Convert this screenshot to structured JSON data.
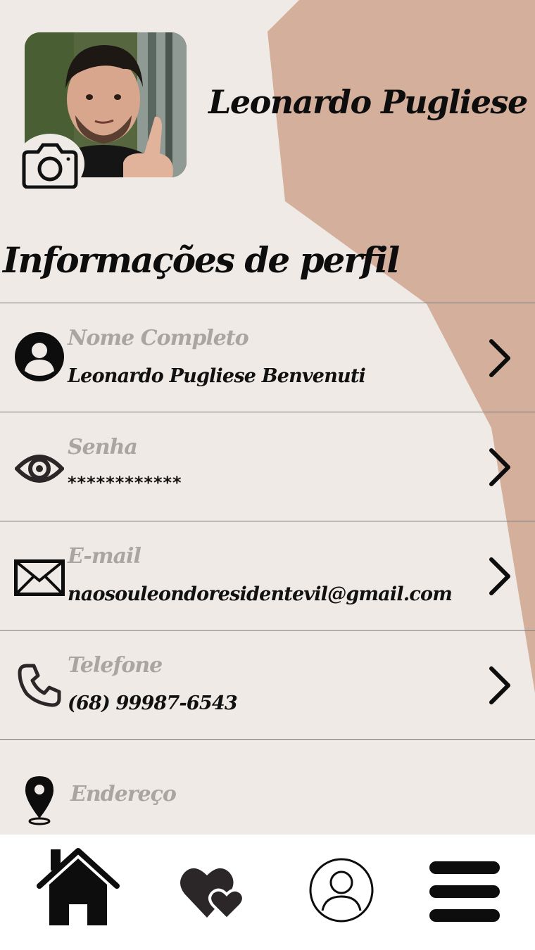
{
  "profile": {
    "name": "Leonardo Pugliese",
    "photo_alt": "avatar"
  },
  "section_title": "Informações de perfil",
  "fields": [
    {
      "label": "Nome Completo",
      "value": "Leonardo Pugliese Benvenuti",
      "icon": "user-circle-icon"
    },
    {
      "label": "Senha",
      "value": "************",
      "icon": "eye-icon"
    },
    {
      "label": "E-mail",
      "value": "naosouleondoresidentevil@gmail.com",
      "icon": "envelope-icon"
    },
    {
      "label": "Telefone",
      "value": "(68) 99987-6543",
      "icon": "phone-icon"
    },
    {
      "label": "Endereço",
      "value": "",
      "icon": "map-pin-icon"
    }
  ],
  "nav": [
    {
      "name": "home",
      "icon": "home-icon"
    },
    {
      "name": "favorites",
      "icon": "hearts-icon"
    },
    {
      "name": "profile",
      "icon": "profile-icon"
    },
    {
      "name": "menu",
      "icon": "menu-icon"
    }
  ],
  "colors": {
    "background": "#f0eae6",
    "accent_shape": "#d4b09c",
    "label_gray": "#a9a5a2",
    "text": "#111111"
  }
}
